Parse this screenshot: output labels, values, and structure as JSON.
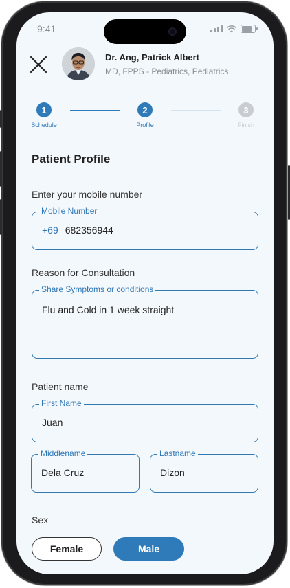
{
  "status_bar": {
    "time": "9:41"
  },
  "doctor": {
    "name": "Dr. Ang, Patrick Albert",
    "credentials": "MD, FPPS - Pediatrics, Pediatrics"
  },
  "stepper": {
    "steps": [
      {
        "number": "1",
        "label": "Schedule",
        "state": "done"
      },
      {
        "number": "2",
        "label": "Profile",
        "state": "active"
      },
      {
        "number": "3",
        "label": "Finish",
        "state": "pending"
      }
    ]
  },
  "form": {
    "title": "Patient Profile",
    "mobile": {
      "section_label": "Enter your mobile number",
      "legend": "Mobile Number",
      "prefix": "+69",
      "value": "682356944"
    },
    "reason": {
      "section_label": "Reason for Consultation",
      "legend": "Share Symptoms or conditions",
      "value": "Flu and Cold in 1 week straight"
    },
    "patient_name": {
      "section_label": "Patient name",
      "first": {
        "legend": "First Name",
        "value": "Juan"
      },
      "middle": {
        "legend": "Middlename",
        "value": "Dela Cruz"
      },
      "last": {
        "legend": "Lastname",
        "value": "Dizon"
      }
    },
    "sex": {
      "section_label": "Sex",
      "options": [
        "Female",
        "Male"
      ],
      "selected": "Male"
    }
  },
  "colors": {
    "accent": "#2f7ab8",
    "inactive": "#c9cdd1",
    "background": "#f3f8fc"
  },
  "icons": [
    "close-icon",
    "signal-icon",
    "wifi-icon",
    "battery-icon"
  ]
}
